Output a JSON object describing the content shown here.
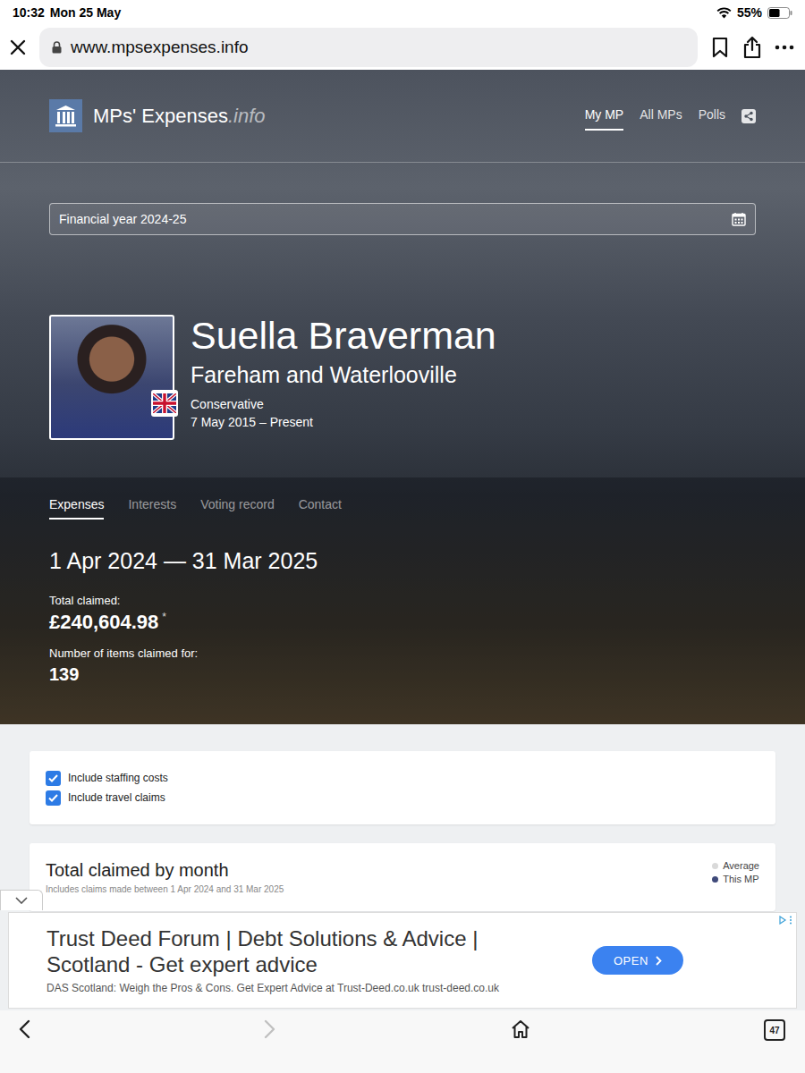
{
  "status_bar": {
    "time": "10:32",
    "date": "Mon 25 May",
    "battery": "55%",
    "battery_level": 0.55
  },
  "browser": {
    "address": "www.mpsexpenses.info",
    "tab_count": "47",
    "back_disabled": false,
    "forward_disabled": true
  },
  "site": {
    "logo_name": "MPs' Expenses",
    "logo_suffix": ".info",
    "nav": [
      {
        "label": "My MP",
        "selected": true
      },
      {
        "label": "All MPs",
        "selected": false
      },
      {
        "label": "Polls",
        "selected": false
      }
    ]
  },
  "year_picker": {
    "value": "Financial year 2024-25"
  },
  "mp": {
    "name": "Suella Braverman",
    "constituency": "Fareham and Waterlooville",
    "party": "Conservative",
    "term": "7 May 2015 – Present"
  },
  "tabs": [
    {
      "label": "Expenses",
      "selected": true
    },
    {
      "label": "Interests",
      "selected": false
    },
    {
      "label": "Voting record",
      "selected": false
    },
    {
      "label": "Contact",
      "selected": false
    }
  ],
  "summary": {
    "period": "1 Apr 2024 — 31 Mar 2025",
    "total_label": "Total claimed:",
    "total": "£240,604.98",
    "total_mark": "*",
    "items_label": "Number of items claimed for:",
    "items": "139"
  },
  "filters": [
    {
      "label": "Include staffing costs",
      "checked": true
    },
    {
      "label": "Include travel claims",
      "checked": true
    }
  ],
  "chart": {
    "title": "Total claimed by month",
    "subtitle": "Includes claims made between 1 Apr 2024 and 31 Mar 2025",
    "legend": [
      {
        "label": "Average",
        "color": "#d9d9d9"
      },
      {
        "label": "This MP",
        "color": "#3f4a7a"
      }
    ]
  },
  "ad": {
    "title": "Trust Deed Forum | Debt Solutions & Advice | Scotland - Get expert advice",
    "description": "DAS Scotland: Weigh the Pros & Cons. Get Expert Advice at Trust-Deed.co.uk trust-deed.co.uk",
    "button": "OPEN"
  }
}
